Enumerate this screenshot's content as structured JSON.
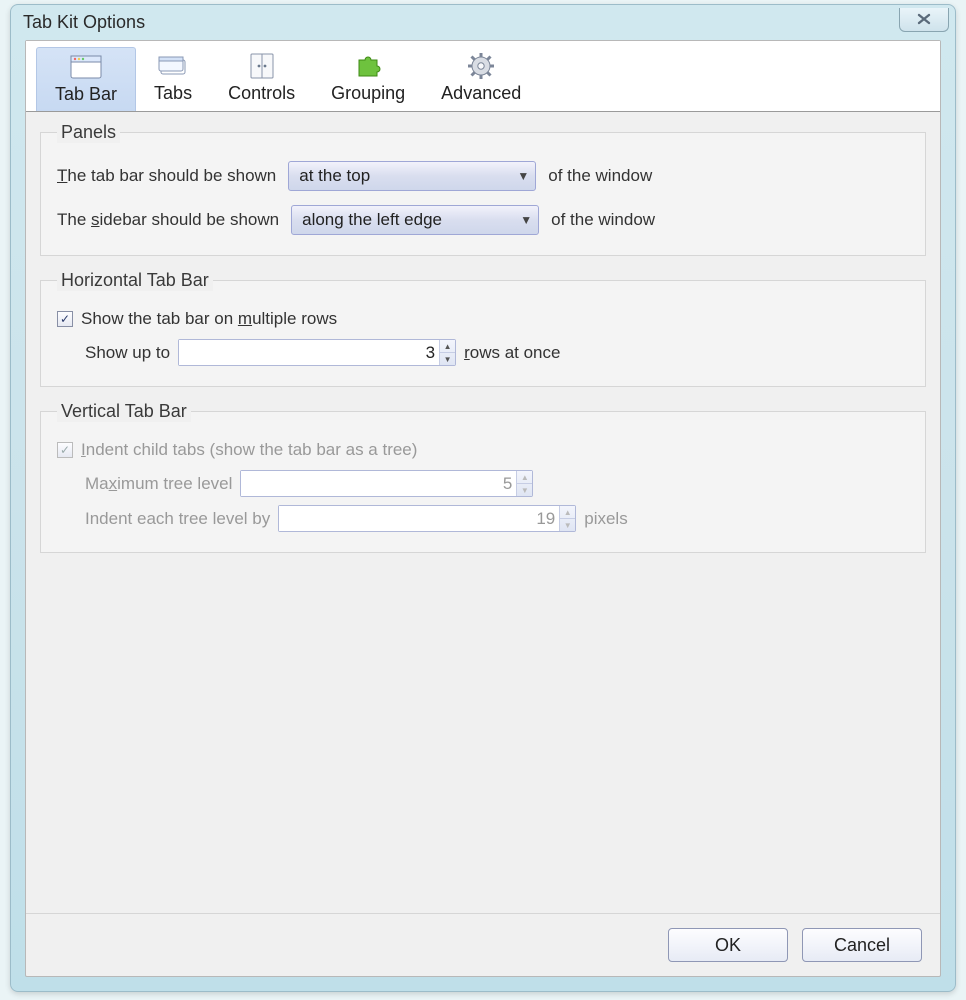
{
  "window": {
    "title": "Tab Kit Options",
    "buttons": {
      "ok": "OK",
      "cancel": "Cancel"
    }
  },
  "toolbar": [
    {
      "label": "Tab Bar",
      "icon": "window-icon",
      "active": true
    },
    {
      "label": "Tabs",
      "icon": "tabs-icon"
    },
    {
      "label": "Controls",
      "icon": "controls-icon"
    },
    {
      "label": "Grouping",
      "icon": "puzzle-icon"
    },
    {
      "label": "Advanced",
      "icon": "gear-icon"
    }
  ],
  "panels": {
    "title": "Panels",
    "tabbar": {
      "prefix_a": "T",
      "prefix_b": "he tab bar should be shown",
      "value": "at the top",
      "suffix": "of the window"
    },
    "sidebar": {
      "prefix_a": "The ",
      "u": "s",
      "prefix_b": "idebar should be shown",
      "value": "along the left edge",
      "suffix": "of the window"
    }
  },
  "horiz": {
    "title": "Horizontal Tab Bar",
    "multi_a": "Show the tab bar on ",
    "multi_u": "m",
    "multi_b": "ultiple rows",
    "rows_label": "Show up to",
    "rows_value": "3",
    "rows_suffix_u": "r",
    "rows_suffix_b": "ows at once"
  },
  "vert": {
    "title": "Vertical Tab Bar",
    "indent_u": "I",
    "indent_b": "ndent child tabs (show the tab bar as a tree)",
    "max_a": "Ma",
    "max_u": "x",
    "max_b": "imum tree level",
    "max_value": "5",
    "each_label": "Indent each tree level by",
    "each_value": "19",
    "each_suffix": "pixels"
  }
}
